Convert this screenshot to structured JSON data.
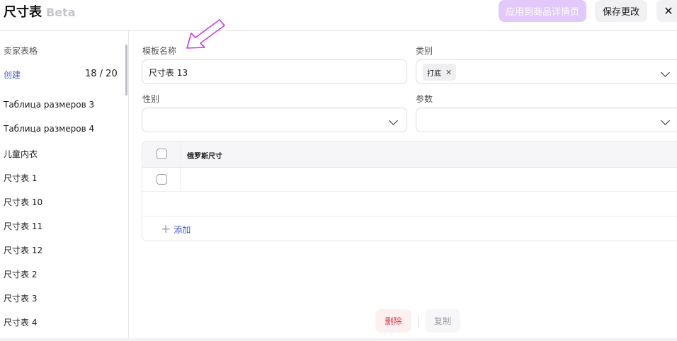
{
  "header": {
    "title": "尺寸表",
    "beta": "Beta",
    "apply_label": "应用到商品详情页",
    "save_label": "保存更改",
    "close_glyph": "✕"
  },
  "sidebar": {
    "heading": "卖家表格",
    "create_label": "创建",
    "count": "18 / 20",
    "items": [
      "Таблица размеров 3",
      "Таблица размеров 4",
      "儿童内衣",
      "尺寸表 1",
      "尺寸表 10",
      "尺寸表 11",
      "尺寸表 12",
      "尺寸表 2",
      "尺寸表 3",
      "尺寸表 4"
    ]
  },
  "form": {
    "template_name_label": "模板名称",
    "template_name_value": "尺寸表 13",
    "category_label": "类别",
    "category_tag": "打底",
    "gender_label": "性别",
    "gender_value": "",
    "params_label": "参数",
    "params_value": ""
  },
  "table": {
    "column_header": "俄罗斯尺寸",
    "add_label": "添加"
  },
  "footer": {
    "delete_label": "删除",
    "copy_label": "复制"
  },
  "colors": {
    "accent": "#3d57d6",
    "apply_button_bg": "#e3c9fb",
    "delete_text": "#e03c4b",
    "annotation_arrow": "#c43cf0"
  }
}
